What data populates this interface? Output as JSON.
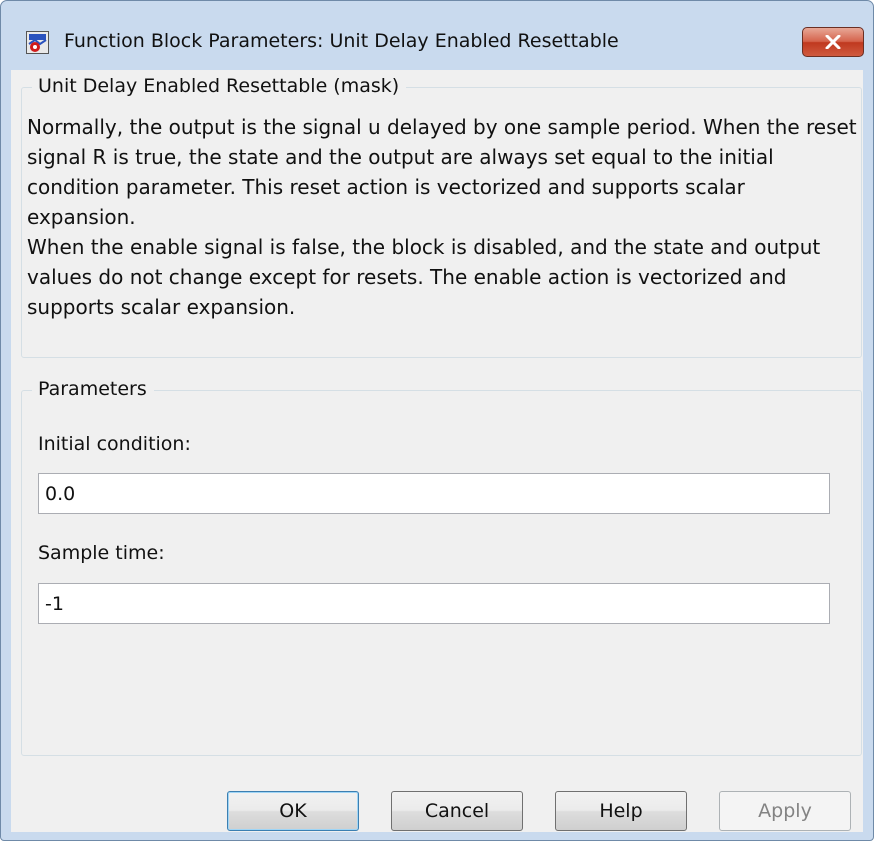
{
  "window": {
    "title": "Function Block Parameters: Unit Delay Enabled Resettable",
    "icon": "simulink-block-icon",
    "close_icon": "close-icon"
  },
  "description_group": {
    "title": "Unit Delay Enabled Resettable (mask)",
    "paragraph_1": "Normally, the output is the signal u delayed by one sample period. When the reset signal R is true, the state and the output are always set equal to the initial condition parameter.  This reset action is vectorized and supports scalar expansion.",
    "paragraph_2": "When the enable signal is false, the block is disabled, and the state and output values do not change except for resets.  The enable action is vectorized and supports scalar expansion."
  },
  "parameters_group": {
    "title": "Parameters",
    "initial_condition": {
      "label": "Initial condition:",
      "value": "0.0"
    },
    "sample_time": {
      "label": "Sample time:",
      "value": "-1"
    }
  },
  "buttons": {
    "ok": "OK",
    "cancel": "Cancel",
    "help": "Help",
    "apply": "Apply",
    "apply_enabled": false
  },
  "colors": {
    "frame": "#c9daee",
    "client": "#f0f0f0",
    "close_button": "#c0391f",
    "default_button_border": "#3c7fb1"
  }
}
